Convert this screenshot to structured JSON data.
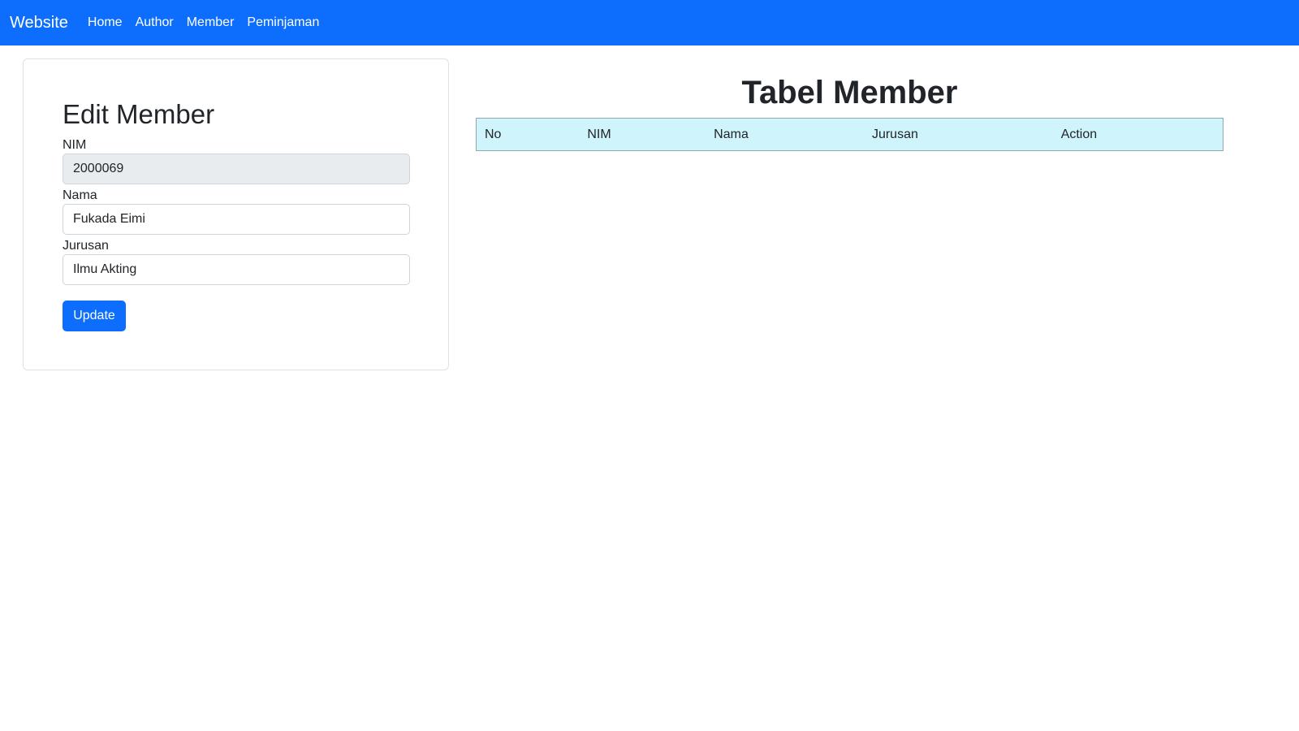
{
  "navbar": {
    "brand": "Website",
    "links": [
      "Home",
      "Author",
      "Member",
      "Peminjaman"
    ],
    "color": "#0d6efd"
  },
  "form": {
    "title": "Edit Member",
    "fields": [
      {
        "label": "NIM",
        "value": "2000069",
        "readonly": true
      },
      {
        "label": "Nama",
        "value": "Fukada Eimi",
        "readonly": false
      },
      {
        "label": "Jurusan",
        "value": "Ilmu Akting",
        "readonly": false
      }
    ],
    "submit_label": "Update"
  },
  "table": {
    "title": "Tabel Member",
    "columns": [
      "No",
      "NIM",
      "Nama",
      "Jurusan",
      "Action"
    ],
    "rows": [],
    "header_color": "#cff4fc"
  }
}
